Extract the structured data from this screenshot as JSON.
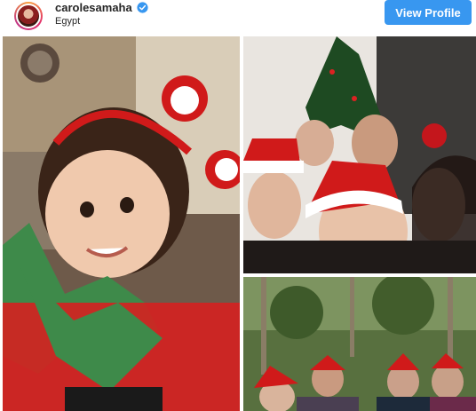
{
  "post": {
    "username": "carolesamaha",
    "location": "Egypt",
    "verified": true,
    "view_profile_label": "View Profile",
    "accent_color": "#3897f0",
    "icons": {
      "verified": "verified-badge-icon"
    }
  },
  "photos": [
    {
      "subject": "child-elf-costume"
    },
    {
      "subject": "family-selfie-santa-hats"
    },
    {
      "subject": "group-garden-santa-hats"
    }
  ]
}
